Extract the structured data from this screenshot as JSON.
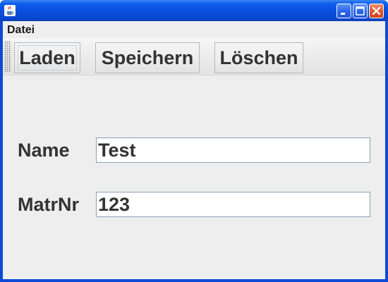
{
  "window": {
    "icon": "java-cup-icon",
    "controls": [
      "minimize-icon",
      "maximize-icon",
      "close-icon"
    ],
    "title_bar_color": "#0a4fdc"
  },
  "menubar": {
    "items": [
      {
        "label": "Datei"
      }
    ]
  },
  "toolbar": {
    "buttons": [
      {
        "label": "Laden"
      },
      {
        "label": "Speichern"
      },
      {
        "label": "Löschen"
      }
    ]
  },
  "form": {
    "name": {
      "label": "Name",
      "value": "Test"
    },
    "matrnr": {
      "label": "MatrNr",
      "value": "123"
    }
  }
}
